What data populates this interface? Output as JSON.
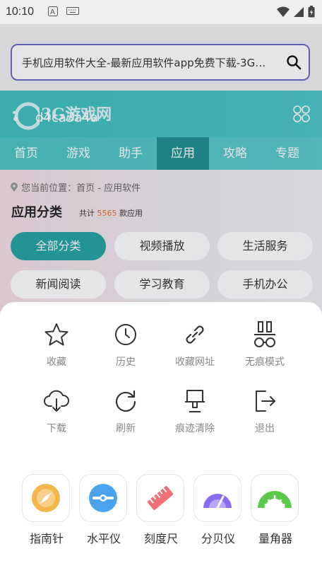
{
  "status": {
    "time": "10:10"
  },
  "search": {
    "query": "手机应用软件大全-最新应用软件app免费下载-3G…"
  },
  "header": {
    "logo_text": "3G游戏网",
    "overlay_text": "d4ca3a4a",
    "nav": [
      {
        "label": "首页"
      },
      {
        "label": "游戏"
      },
      {
        "label": "助手"
      },
      {
        "label": "应用"
      },
      {
        "label": "攻略"
      },
      {
        "label": "专题"
      }
    ]
  },
  "content": {
    "breadcrumb": "您当前位置：首页 - 应用软件",
    "category_title": "应用分类",
    "count_prefix": "共计",
    "count_num": "5565",
    "count_suffix": "款应用",
    "categories": [
      {
        "label": "全部分类"
      },
      {
        "label": "视频播放"
      },
      {
        "label": "生活服务"
      },
      {
        "label": "新闻阅读"
      },
      {
        "label": "学习教育"
      },
      {
        "label": "手机办公"
      }
    ]
  },
  "menu": {
    "items": [
      {
        "label": "收藏",
        "icon": "star-icon"
      },
      {
        "label": "历史",
        "icon": "clock-icon"
      },
      {
        "label": "收藏网址",
        "icon": "link-icon"
      },
      {
        "label": "无痕模式",
        "icon": "incognito-icon"
      },
      {
        "label": "下载",
        "icon": "cloud-download-icon"
      },
      {
        "label": "刷新",
        "icon": "refresh-icon"
      },
      {
        "label": "痕迹清除",
        "icon": "brush-icon"
      },
      {
        "label": "退出",
        "icon": "exit-icon"
      }
    ],
    "tools": [
      {
        "label": "指南针",
        "icon": "compass-icon"
      },
      {
        "label": "水平仪",
        "icon": "level-icon"
      },
      {
        "label": "刻度尺",
        "icon": "ruler-icon"
      },
      {
        "label": "分贝仪",
        "icon": "decibel-icon"
      },
      {
        "label": "量角器",
        "icon": "protractor-icon"
      }
    ]
  },
  "colors": {
    "accent": "#23a3a3",
    "search_border": "#6b69c8"
  }
}
